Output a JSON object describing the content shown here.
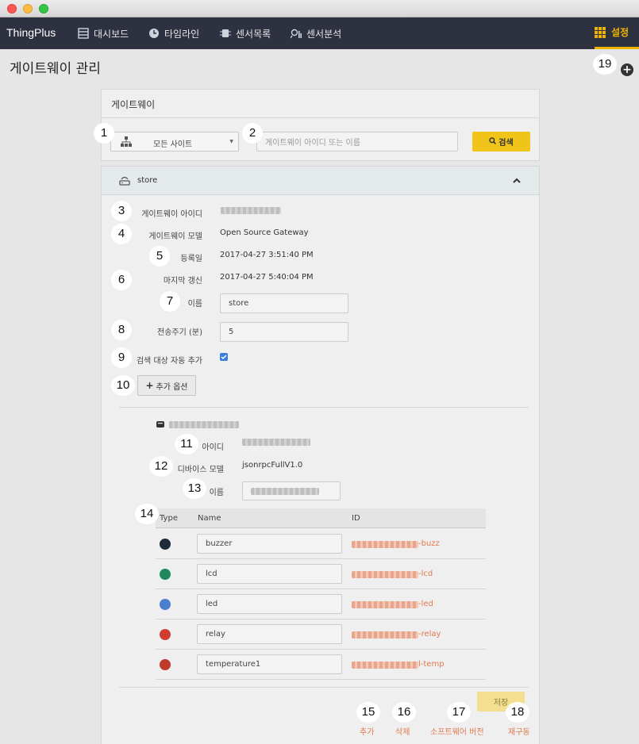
{
  "colors": {
    "accent": "#f0b400",
    "nav_bg": "#2d3140",
    "link": "#e07a4f"
  },
  "nav": {
    "brand": "ThingPlus",
    "items": [
      {
        "label": "대시보드",
        "icon": "dashboard-icon"
      },
      {
        "label": "타임라인",
        "icon": "clock-icon"
      },
      {
        "label": "센서목록",
        "icon": "chip-icon"
      },
      {
        "label": "센서분석",
        "icon": "analytics-icon"
      }
    ],
    "settings": {
      "label": "설정",
      "icon": "grid-icon"
    }
  },
  "page": {
    "title": "게이트웨이 관리"
  },
  "gateway_panel": {
    "title": "게이트웨이",
    "site_select": "모든 사이트",
    "search_placeholder": "게이트웨이 아이디 또는 이름",
    "search_button": "검색"
  },
  "store": {
    "name": "store",
    "fields": {
      "gateway_id_label": "게이트웨이 아이디",
      "gateway_model_label": "게이트웨이 모델",
      "gateway_model_value": "Open Source Gateway",
      "registered_label": "등록일",
      "registered_value": "2017-04-27 3:51:40 PM",
      "last_update_label": "마지막 갱신",
      "last_update_value": "2017-04-27 5:40:04 PM",
      "name_label": "이름",
      "name_value": "store",
      "period_label": "전송주기 (분)",
      "period_value": "5",
      "auto_add_label": "검색 대상 자동 추가",
      "auto_add_checked": true,
      "more_options": "추가 옵션"
    }
  },
  "device": {
    "id_label": "아이디",
    "model_label": "디바이스 모델",
    "model_value": "jsonrpcFullV1.0",
    "name_label": "이름",
    "columns": {
      "type": "Type",
      "name": "Name",
      "id": "ID"
    },
    "sensors": [
      {
        "name": "buzzer",
        "id_suffix": "-buzz",
        "color": "#1f2b3a",
        "icon": "buzzer-icon"
      },
      {
        "name": "lcd",
        "id_suffix": "-lcd",
        "color": "#1e8a5a",
        "icon": "lcd-icon"
      },
      {
        "name": "led",
        "id_suffix": "-led",
        "color": "#4a7fd0",
        "icon": "led-icon"
      },
      {
        "name": "relay",
        "id_suffix": "-relay",
        "color": "#d23b2f",
        "icon": "power-icon"
      },
      {
        "name": "temperature1",
        "id_suffix": "l-temp",
        "color": "#c0392b",
        "icon": "thermometer-icon"
      }
    ]
  },
  "footer": {
    "save": "저장",
    "add": "추가",
    "delete": "삭제",
    "software_version": "소프트웨어 버전",
    "restart": "재구동"
  },
  "badges": [
    "1",
    "2",
    "3",
    "4",
    "5",
    "6",
    "7",
    "8",
    "9",
    "10",
    "11",
    "12",
    "13",
    "14",
    "15",
    "16",
    "17",
    "18",
    "19"
  ]
}
